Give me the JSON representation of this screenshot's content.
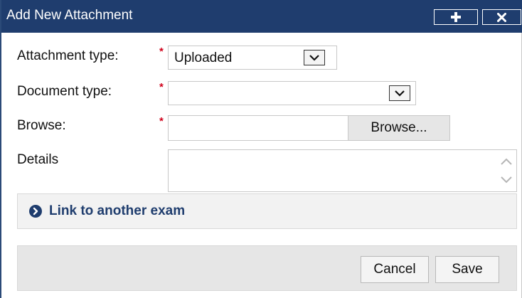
{
  "dialog": {
    "title": "Add New Attachment",
    "title_buttons": [
      {
        "name": "add",
        "icon": "plus-icon"
      },
      {
        "name": "close",
        "icon": "close-icon"
      }
    ],
    "colors": {
      "titlebar": "#1f3d6e",
      "required_marker": "#d0021b",
      "link_text": "#1f3d6e"
    }
  },
  "form": {
    "required_marker": "*",
    "attachment_type": {
      "label": "Attachment type:",
      "value": "Uploaded"
    },
    "document_type": {
      "label": "Document type:",
      "value": ""
    },
    "browse": {
      "label": "Browse:",
      "value": "",
      "button_label": "Browse..."
    },
    "details": {
      "label": "Details",
      "value": ""
    }
  },
  "link_section": {
    "icon": "chevron-right-circle-icon",
    "label": "Link to another exam"
  },
  "footer": {
    "cancel_label": "Cancel",
    "save_label": "Save"
  }
}
